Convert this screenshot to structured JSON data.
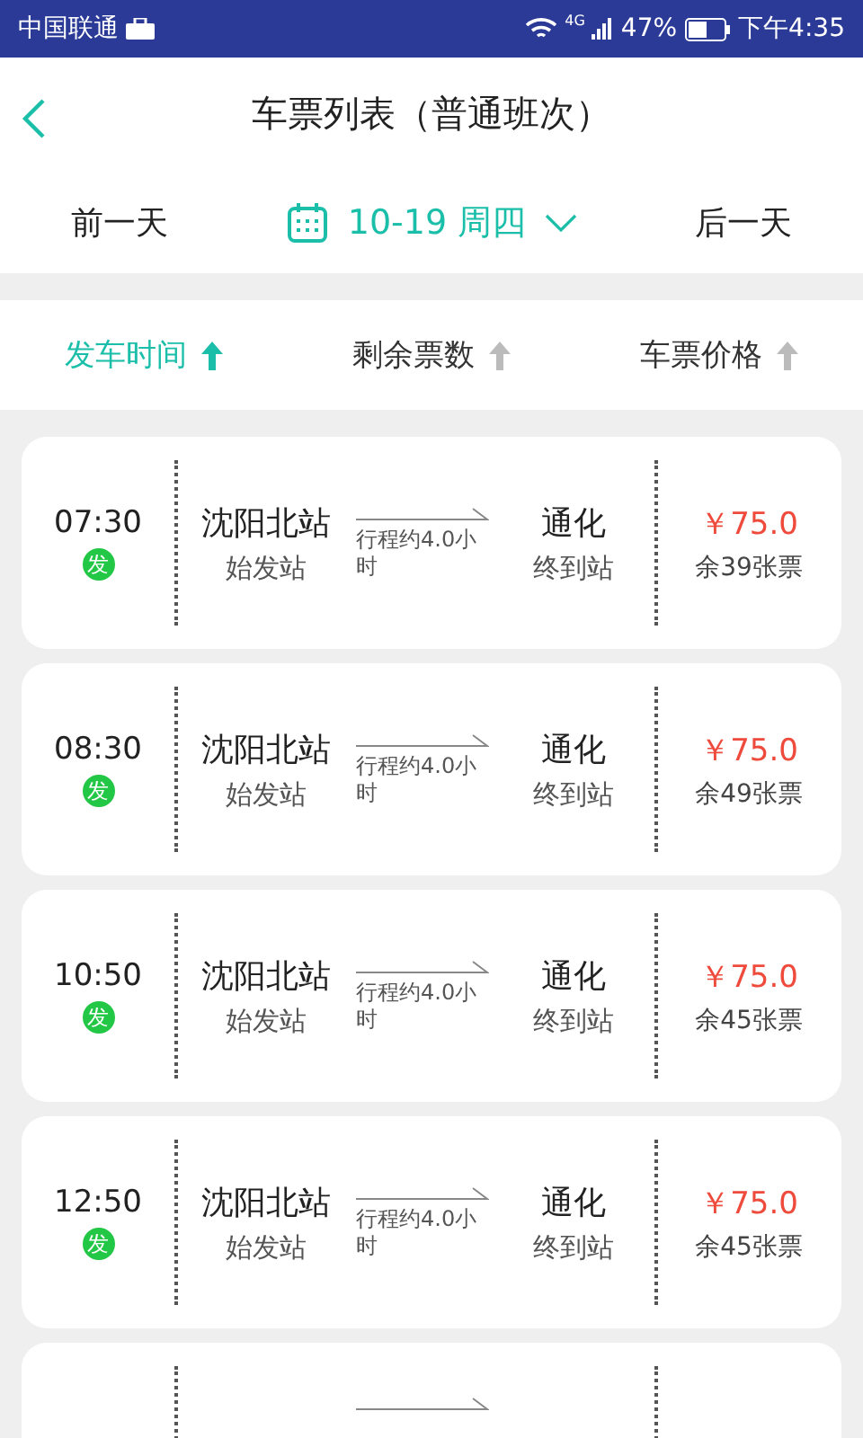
{
  "status_bar": {
    "carrier": "中国联通",
    "network": "4G",
    "battery": "47%",
    "time": "下午4:35"
  },
  "header": {
    "title": "车票列表（普通班次）"
  },
  "date_bar": {
    "prev": "前一天",
    "date": "10-19 周四",
    "next": "后一天"
  },
  "sort_options": [
    {
      "label": "发车时间",
      "selected": true
    },
    {
      "label": "剩余票数",
      "selected": false
    },
    {
      "label": "车票价格",
      "selected": false
    }
  ],
  "trips": [
    {
      "time": "07:30",
      "badge": "发",
      "from": "沈阳北站",
      "from_note": "始发站",
      "duration": "行程约4.0小时",
      "to": "通化",
      "to_note": "终到站",
      "price": "￥75.0",
      "remaining": "余39张票"
    },
    {
      "time": "08:30",
      "badge": "发",
      "from": "沈阳北站",
      "from_note": "始发站",
      "duration": "行程约4.0小时",
      "to": "通化",
      "to_note": "终到站",
      "price": "￥75.0",
      "remaining": "余49张票"
    },
    {
      "time": "10:50",
      "badge": "发",
      "from": "沈阳北站",
      "from_note": "始发站",
      "duration": "行程约4.0小时",
      "to": "通化",
      "to_note": "终到站",
      "price": "￥75.0",
      "remaining": "余45张票"
    },
    {
      "time": "12:50",
      "badge": "发",
      "from": "沈阳北站",
      "from_note": "始发站",
      "duration": "行程约4.0小时",
      "to": "通化",
      "to_note": "终到站",
      "price": "￥75.0",
      "remaining": "余45张票"
    }
  ],
  "list_continues": true
}
